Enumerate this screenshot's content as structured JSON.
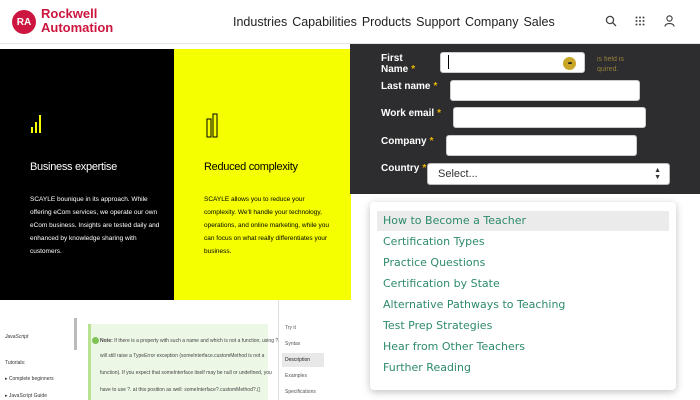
{
  "header": {
    "logo_badge": "RA",
    "logo_line1": "Rockwell",
    "logo_line2": "Automation",
    "nav": [
      "Industries",
      "Capabilities",
      "Products",
      "Support",
      "Company",
      "Sales"
    ]
  },
  "icons": {
    "search": "search-icon",
    "apps": "grid-icon",
    "user": "user-icon"
  },
  "panels": {
    "black": {
      "title": "Business expertise",
      "body": "SCAYLE bounique in its approach. While offering eCom services, we operate our own eCom business. Insights are tested daily and enhanced by knowledge sharing with customers."
    },
    "yellow": {
      "title": "Reduced complexity",
      "body": "SCAYLE allows you to reduce your complexity. We'll handle your technology, operations, and online marketing, while you can focus on what really differentiates your business."
    }
  },
  "form": {
    "first_name_label_1": "First",
    "first_name_label_2": "Name",
    "required_mark": "*",
    "error_line1": "is field is",
    "error_line2": "quired.",
    "last_name_label": "Last name",
    "work_email_label": "Work email",
    "company_label": "Company",
    "country_label": "Country",
    "country_value": "Select...",
    "warning_glyph": "•••"
  },
  "doc": {
    "js_label": "JavaScript",
    "tutorials": "Tutorials:",
    "complete_beginners": "▸ Complete beginners",
    "js_guide": "▸ JavaScript Guide",
    "note_line1_bold": "Note:",
    "note_line1": "If there is a property with such a name and which is not a function, using ?.",
    "note_line2": "will still raise a TypeError exception (someInterface.customMethod is not a",
    "note_line3": "function). If you expect that someInterface itself may be null or undefined, you",
    "note_line4": "have to use ?. at this position as well: someInterface?.customMethod?.()",
    "toc": [
      "Try it",
      "Syntax",
      "Description",
      "Examples",
      "Specifications"
    ]
  },
  "menu": {
    "items": [
      "How to Become a Teacher",
      "Certification Types",
      "Practice Questions",
      "Certification by State",
      "Alternative Pathways to Teaching",
      "Test Prep Strategies",
      "Hear from Other Teachers",
      "Further Reading"
    ],
    "active_index": 0
  },
  "colors": {
    "brand": "#cd163f",
    "yellow_panel": "#f5ff00",
    "form_bg": "#2d2c2e",
    "menu_text": "#2e8b6a"
  }
}
